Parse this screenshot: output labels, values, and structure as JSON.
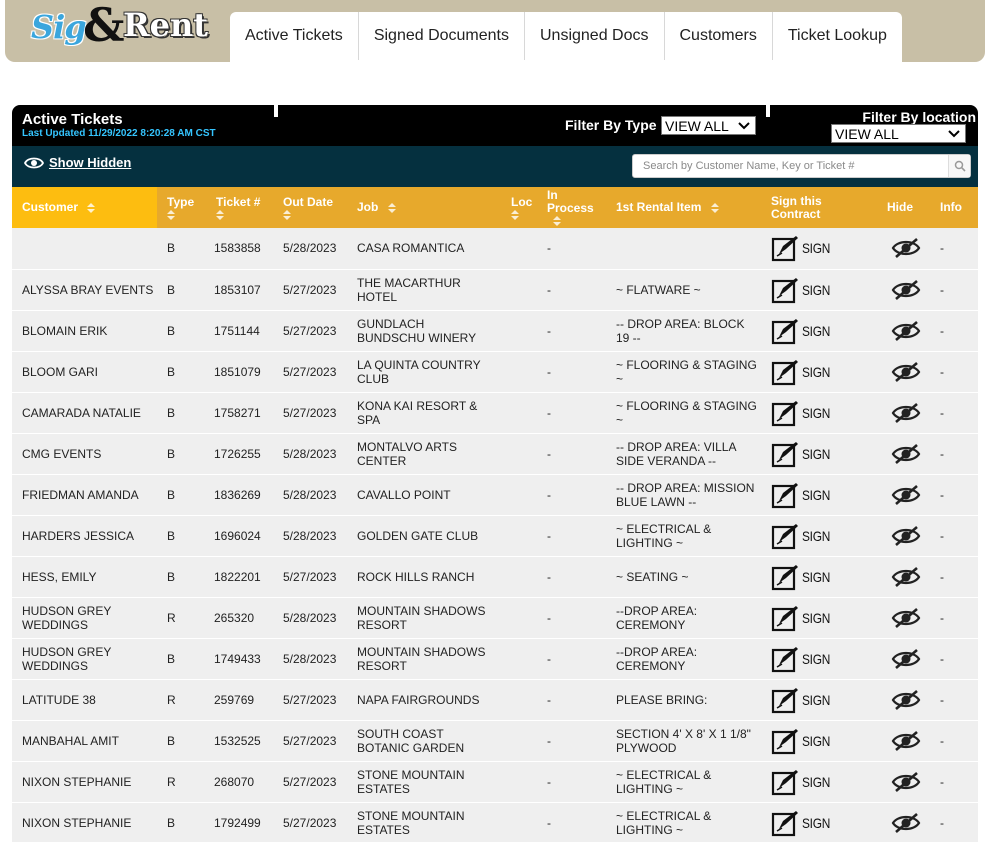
{
  "logo": {
    "part1": "Sig",
    "part2": "&",
    "part3": "Rent"
  },
  "nav": {
    "tabs": [
      {
        "label": "Active Tickets"
      },
      {
        "label": "Signed Documents"
      },
      {
        "label": "Unsigned Docs"
      },
      {
        "label": "Customers"
      },
      {
        "label": "Ticket Lookup"
      }
    ]
  },
  "header": {
    "title": "Active Tickets",
    "last_updated": "Last Updated 11/29/2022 8:20:28 AM CST",
    "filter_type_label": "Filter By Type",
    "filter_type_value": "VIEW ALL",
    "filter_location_label": "Filter By location",
    "filter_location_value": "VIEW ALL"
  },
  "toolbar": {
    "show_hidden_label": "Show Hidden",
    "search_placeholder": "Search by Customer Name, Key or Ticket #"
  },
  "table": {
    "columns": {
      "customer": "Customer",
      "type": "Type",
      "ticket": "Ticket #",
      "out_date": "Out Date",
      "job": "Job",
      "loc": "Loc",
      "in_process": "In Process",
      "rental_item": "1st Rental Item",
      "sign": "Sign this Contract",
      "hide": "Hide",
      "info": "Info"
    },
    "sign_label": "SIGN",
    "rows": [
      {
        "customer": "",
        "type": "B",
        "ticket": "1583858",
        "out_date": "5/28/2023",
        "job": "CASA ROMANTICA",
        "loc": "",
        "in_process": "-",
        "rental_item": "",
        "info": "-"
      },
      {
        "customer": "ALYSSA BRAY EVENTS",
        "type": "B",
        "ticket": "1853107",
        "out_date": "5/27/2023",
        "job": "THE MACARTHUR HOTEL",
        "loc": "",
        "in_process": "-",
        "rental_item": "~ FLATWARE ~",
        "info": "-"
      },
      {
        "customer": "BLOMAIN ERIK",
        "type": "B",
        "ticket": "1751144",
        "out_date": "5/27/2023",
        "job": "GUNDLACH BUNDSCHU WINERY",
        "loc": "",
        "in_process": "-",
        "rental_item": "-- DROP AREA: BLOCK 19 --",
        "info": "-"
      },
      {
        "customer": "BLOOM GARI",
        "type": "B",
        "ticket": "1851079",
        "out_date": "5/27/2023",
        "job": "LA QUINTA COUNTRY CLUB",
        "loc": "",
        "in_process": "-",
        "rental_item": "~ FLOORING & STAGING ~",
        "info": "-"
      },
      {
        "customer": "CAMARADA NATALIE",
        "type": "B",
        "ticket": "1758271",
        "out_date": "5/27/2023",
        "job": "KONA KAI RESORT & SPA",
        "loc": "",
        "in_process": "-",
        "rental_item": "~ FLOORING & STAGING ~",
        "info": "-"
      },
      {
        "customer": "CMG EVENTS",
        "type": "B",
        "ticket": "1726255",
        "out_date": "5/28/2023",
        "job": "MONTALVO ARTS CENTER",
        "loc": "",
        "in_process": "-",
        "rental_item": "-- DROP AREA: VILLA SIDE VERANDA --",
        "info": "-"
      },
      {
        "customer": "FRIEDMAN AMANDA",
        "type": "B",
        "ticket": "1836269",
        "out_date": "5/28/2023",
        "job": "CAVALLO POINT",
        "loc": "",
        "in_process": "-",
        "rental_item": "-- DROP AREA: MISSION BLUE LAWN --",
        "info": "-"
      },
      {
        "customer": "HARDERS JESSICA",
        "type": "B",
        "ticket": "1696024",
        "out_date": "5/28/2023",
        "job": "GOLDEN GATE CLUB",
        "loc": "",
        "in_process": "-",
        "rental_item": "~ ELECTRICAL & LIGHTING ~",
        "info": "-"
      },
      {
        "customer": "HESS, EMILY",
        "type": "B",
        "ticket": "1822201",
        "out_date": "5/27/2023",
        "job": "ROCK HILLS RANCH",
        "loc": "",
        "in_process": "-",
        "rental_item": "~ SEATING ~",
        "info": "-"
      },
      {
        "customer": "HUDSON GREY WEDDINGS",
        "type": "R",
        "ticket": "265320",
        "out_date": "5/28/2023",
        "job": "MOUNTAIN SHADOWS RESORT",
        "loc": "",
        "in_process": "-",
        "rental_item": "--DROP AREA: CEREMONY",
        "info": "-"
      },
      {
        "customer": "HUDSON GREY WEDDINGS",
        "type": "B",
        "ticket": "1749433",
        "out_date": "5/28/2023",
        "job": "MOUNTAIN SHADOWS RESORT",
        "loc": "",
        "in_process": "-",
        "rental_item": "--DROP AREA: CEREMONY",
        "info": "-"
      },
      {
        "customer": "LATITUDE 38",
        "type": "R",
        "ticket": "259769",
        "out_date": "5/27/2023",
        "job": "NAPA FAIRGROUNDS",
        "loc": "",
        "in_process": "-",
        "rental_item": "PLEASE BRING:",
        "info": "-"
      },
      {
        "customer": "MANBAHAL AMIT",
        "type": "B",
        "ticket": "1532525",
        "out_date": "5/27/2023",
        "job": "SOUTH COAST BOTANIC GARDEN",
        "loc": "",
        "in_process": "-",
        "rental_item": "SECTION 4' X 8' X 1 1/8\" PLYWOOD",
        "info": "-"
      },
      {
        "customer": "NIXON STEPHANIE",
        "type": "R",
        "ticket": "268070",
        "out_date": "5/27/2023",
        "job": "STONE MOUNTAIN ESTATES",
        "loc": "",
        "in_process": "-",
        "rental_item": "~ ELECTRICAL & LIGHTING ~",
        "info": "-"
      },
      {
        "customer": "NIXON STEPHANIE",
        "type": "B",
        "ticket": "1792499",
        "out_date": "5/27/2023",
        "job": "STONE MOUNTAIN ESTATES",
        "loc": "",
        "in_process": "-",
        "rental_item": "~ ELECTRICAL & LIGHTING ~",
        "info": "-"
      }
    ]
  }
}
